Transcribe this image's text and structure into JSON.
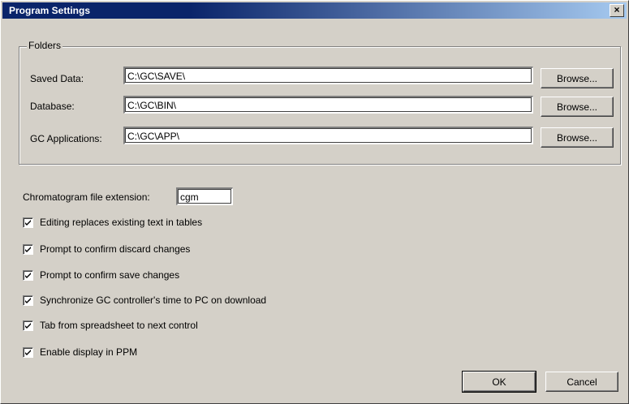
{
  "window": {
    "title": "Program Settings",
    "close_glyph": "×"
  },
  "folders": {
    "legend": "Folders",
    "rows": [
      {
        "label": "Saved Data:",
        "value": "C:\\GC\\SAVE\\",
        "browse": "Browse..."
      },
      {
        "label": "Database:",
        "value": "C:\\GC\\BIN\\",
        "browse": "Browse..."
      },
      {
        "label": "GC Applications:",
        "value": "C:\\GC\\APP\\",
        "browse": "Browse..."
      }
    ]
  },
  "extension": {
    "label": "Chromatogram file extension:",
    "value": "cgm"
  },
  "options": [
    {
      "label": "Editing replaces existing text in tables",
      "checked": true
    },
    {
      "label": "Prompt to confirm discard changes",
      "checked": true
    },
    {
      "label": "Prompt to confirm save changes",
      "checked": true
    },
    {
      "label": "Synchronize GC controller's time to PC on download",
      "checked": true
    },
    {
      "label": "Tab from spreadsheet to next control",
      "checked": true
    },
    {
      "label": "Enable display in PPM",
      "checked": true
    }
  ],
  "buttons": {
    "ok": "OK",
    "cancel": "Cancel"
  }
}
